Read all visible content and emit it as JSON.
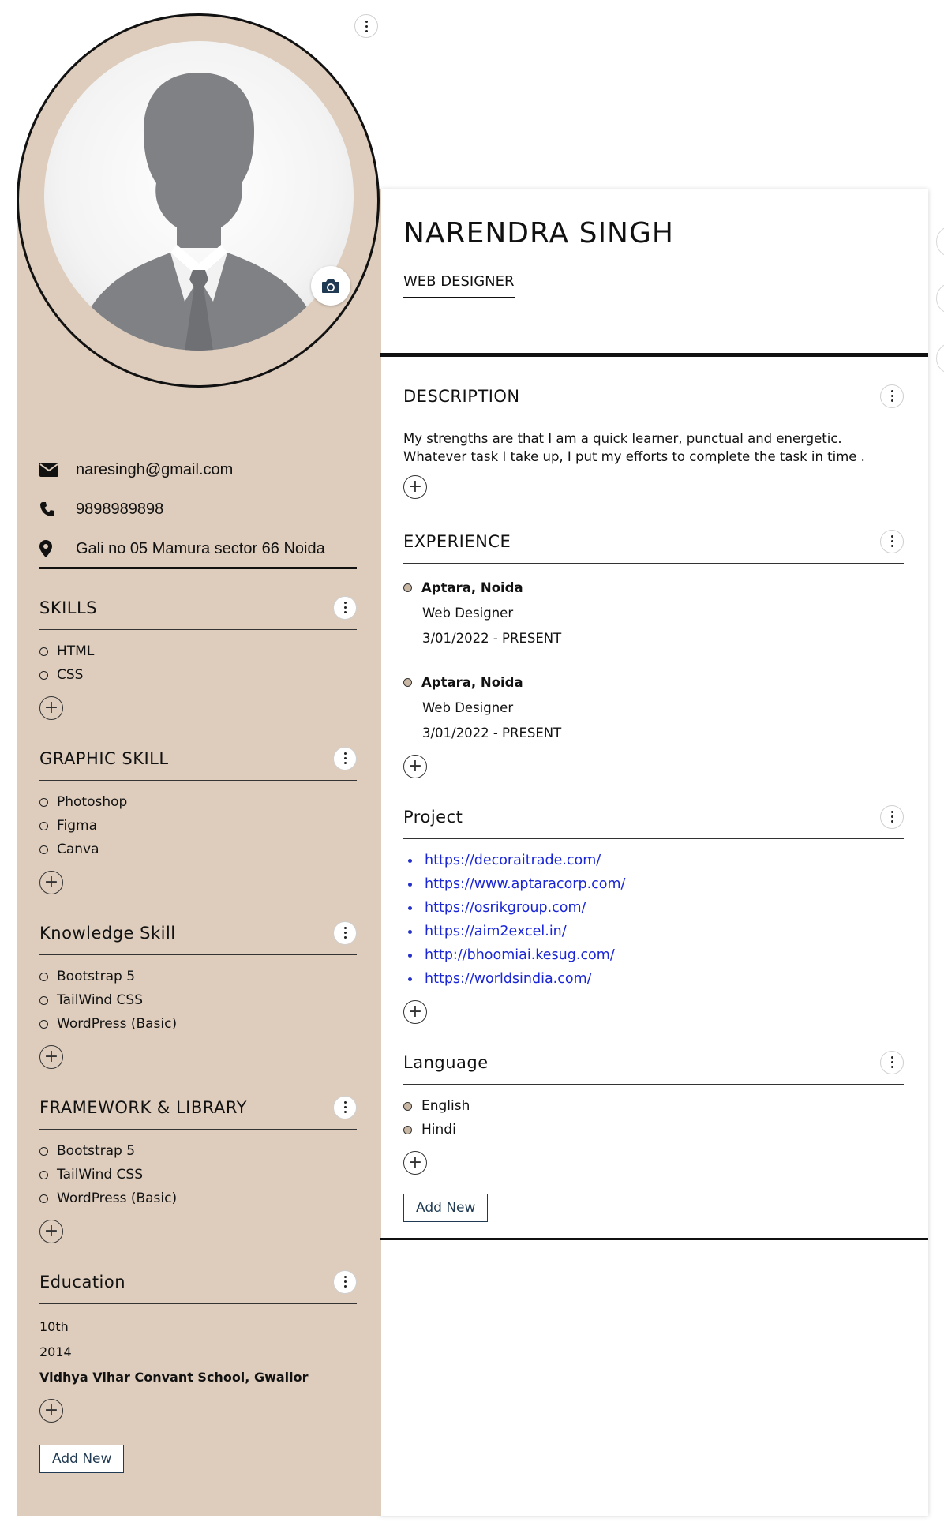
{
  "profile": {
    "name": "NARENDRA SINGH",
    "title": "WEB DESIGNER",
    "email": "naresingh@gmail.com",
    "phone": "9898989898",
    "address": "Gali no 05 Mamura sector 66 Noida"
  },
  "sections": {
    "skills": {
      "title": "SKILLS",
      "items": [
        "HTML",
        "CSS"
      ]
    },
    "graphic": {
      "title": "GRAPHIC SKILL",
      "items": [
        "Photoshop",
        "Figma",
        "Canva"
      ]
    },
    "knowledge": {
      "title": "Knowledge Skill",
      "items": [
        "Bootstrap 5",
        "TailWind CSS",
        "WordPress (Basic)"
      ]
    },
    "framework": {
      "title": "FRAMEWORK & LIBRARY",
      "items": [
        "Bootstrap 5",
        "TailWind CSS",
        "WordPress (Basic)"
      ]
    },
    "education": {
      "title": "Education",
      "level": "10th",
      "year": "2014",
      "school": "Vidhya Vihar Convant School, Gwalior"
    },
    "description": {
      "title": "DESCRIPTION",
      "line1": "My strengths are that I am a quick learner, punctual and energetic.",
      "line2": "Whatever task I take up, I put my efforts to complete the task in time ."
    },
    "experience": {
      "title": "EXPERIENCE",
      "items": [
        {
          "company": "Aptara, Noida",
          "role": "Web Designer",
          "period": "3/01/2022 - PRESENT"
        },
        {
          "company": "Aptara, Noida",
          "role": "Web Designer",
          "period": "3/01/2022 - PRESENT"
        }
      ]
    },
    "project": {
      "title": "Project",
      "links": [
        "https://decoraitrade.com/",
        "https://www.aptaracorp.com/",
        "https://osrikgroup.com/",
        "https://aim2excel.in/",
        "http://bhoomiai.kesug.com/",
        "https://worldsindia.com/"
      ]
    },
    "language": {
      "title": "Language",
      "items": [
        "English",
        "Hindi"
      ]
    }
  },
  "buttons": {
    "add_new": "Add New",
    "add_symbol": "+"
  },
  "icons": {
    "email": "envelope-icon",
    "phone": "phone-icon",
    "address": "map-marker-icon",
    "camera": "camera-icon",
    "menu": "kebab-menu-icon",
    "add": "plus-circle-icon"
  },
  "colors": {
    "sidebar": "#decdbd",
    "link": "#1a26d6",
    "button_border": "#1f3a52"
  }
}
